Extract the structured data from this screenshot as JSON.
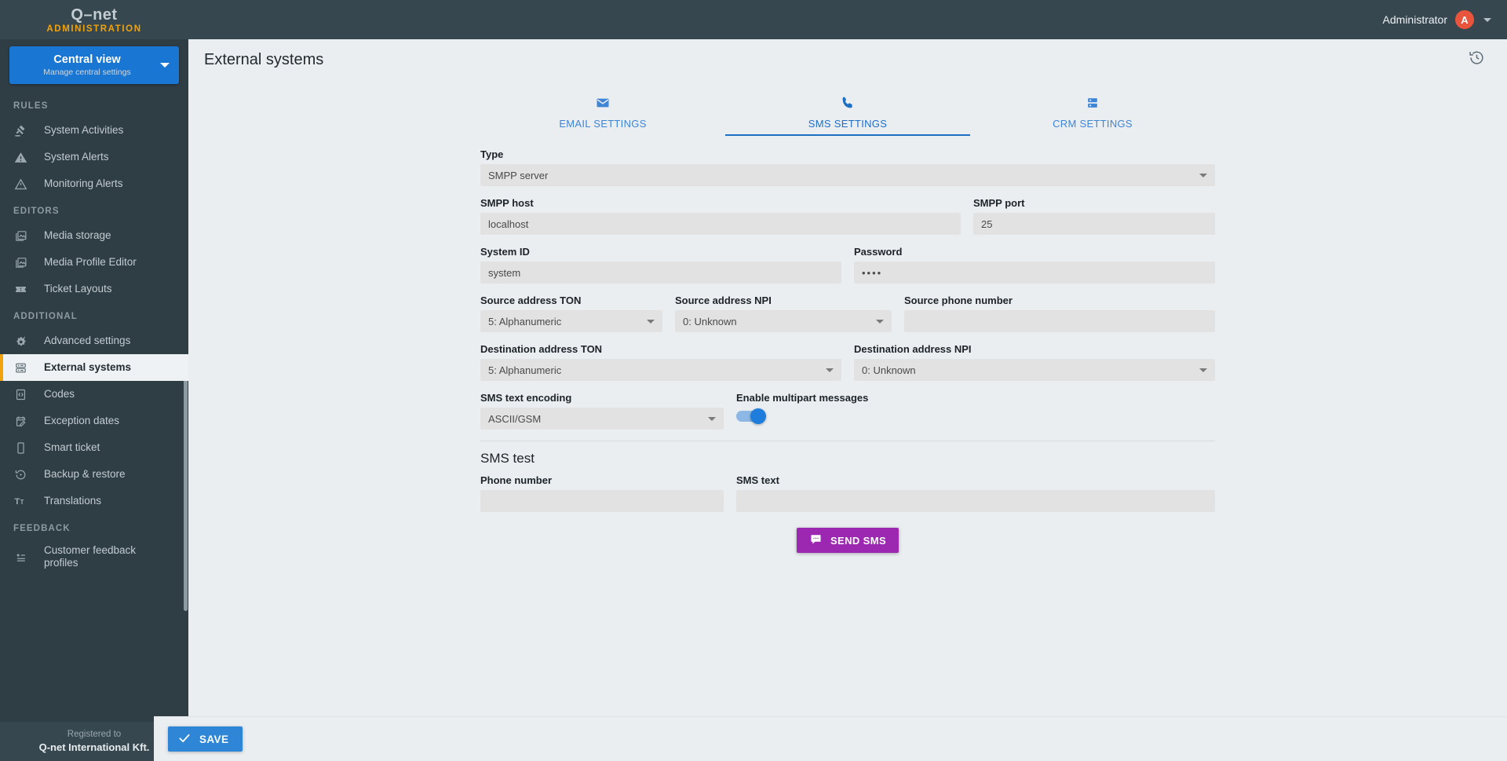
{
  "brand": {
    "logo": "Q–net",
    "logo_mark": "Q-net",
    "subtitle": "ADMINISTRATION"
  },
  "view_selector": {
    "title": "Central view",
    "subtitle": "Manage central settings",
    "icon": "chevron-down-icon"
  },
  "sidebar": {
    "groups": [
      {
        "title": "RULES",
        "items": [
          {
            "label": "System Activities",
            "icon": "gavel-icon",
            "active": false
          },
          {
            "label": "System Alerts",
            "icon": "warning-triangle-icon",
            "active": false
          },
          {
            "label": "Monitoring Alerts",
            "icon": "alert-triangle-outline-icon",
            "active": false
          }
        ]
      },
      {
        "title": "EDITORS",
        "items": [
          {
            "label": "Media storage",
            "icon": "image-stack-icon",
            "active": false
          },
          {
            "label": "Media Profile Editor",
            "icon": "image-stack-icon",
            "active": false
          },
          {
            "label": "Ticket Layouts",
            "icon": "ticket-icon",
            "active": false
          }
        ]
      },
      {
        "title": "ADDITIONAL",
        "items": [
          {
            "label": "Advanced settings",
            "icon": "gear-sparkle-icon",
            "active": false
          },
          {
            "label": "External systems",
            "icon": "server-icon",
            "active": true
          },
          {
            "label": "Codes",
            "icon": "code-brackets-icon",
            "active": false
          },
          {
            "label": "Exception dates",
            "icon": "calendar-edit-icon",
            "active": false
          },
          {
            "label": "Smart ticket",
            "icon": "mobile-phone-icon",
            "active": false
          },
          {
            "label": "Backup & restore",
            "icon": "restore-icon",
            "active": false
          },
          {
            "label": "Translations",
            "icon": "translate-icon",
            "active": false
          }
        ]
      },
      {
        "title": "FEEDBACK",
        "items": [
          {
            "label": "Customer feedback profiles",
            "icon": "feedback-icon",
            "active": false
          }
        ]
      }
    ],
    "registered": {
      "top": "Registered to",
      "name": "Q-net International Kft."
    }
  },
  "topbar": {
    "user": "Administrator",
    "avatar_initial": "A",
    "caret_icon": "chevron-down-icon"
  },
  "page": {
    "title": "External systems",
    "history_icon": "history-restore-icon"
  },
  "tabs": [
    {
      "label": "EMAIL SETTINGS",
      "icon": "envelope-icon",
      "active": false
    },
    {
      "label": "SMS SETTINGS",
      "icon": "phone-icon",
      "active": true
    },
    {
      "label": "CRM SETTINGS",
      "icon": "server-rack-icon",
      "active": false
    }
  ],
  "form": {
    "type": {
      "label": "Type",
      "value": "SMPP server"
    },
    "smpp_host": {
      "label": "SMPP host",
      "value": "localhost"
    },
    "smpp_port": {
      "label": "SMPP port",
      "value": "25"
    },
    "system_id": {
      "label": "System ID",
      "value": "system"
    },
    "password": {
      "label": "Password",
      "value": "••••"
    },
    "source_ton": {
      "label": "Source address TON",
      "value": "5: Alphanumeric"
    },
    "source_npi": {
      "label": "Source address NPI",
      "value": "0: Unknown"
    },
    "source_phone": {
      "label": "Source phone number",
      "value": ""
    },
    "dest_ton": {
      "label": "Destination address TON",
      "value": "5: Alphanumeric"
    },
    "dest_npi": {
      "label": "Destination address NPI",
      "value": "0: Unknown"
    },
    "encoding": {
      "label": "SMS text encoding",
      "value": "ASCII/GSM"
    },
    "multipart": {
      "label": "Enable multipart messages",
      "enabled": true
    }
  },
  "sms_test": {
    "title": "SMS test",
    "phone_number": {
      "label": "Phone number",
      "value": ""
    },
    "sms_text": {
      "label": "SMS text",
      "value": ""
    },
    "send_button": {
      "label": "SEND SMS",
      "icon": "chat-bubble-icon"
    }
  },
  "footer": {
    "save_label": "SAVE",
    "save_icon": "check-icon"
  },
  "colors": {
    "sidebar_bg": "#2f3d45",
    "header_bg": "#37474f",
    "accent_orange": "#f0a30a",
    "accent_blue": "#1976d2",
    "tab_blue": "#1d6fc4",
    "send_purple": "#9c27b0",
    "avatar_red": "#e8553c",
    "page_bg": "#eaeef1"
  }
}
